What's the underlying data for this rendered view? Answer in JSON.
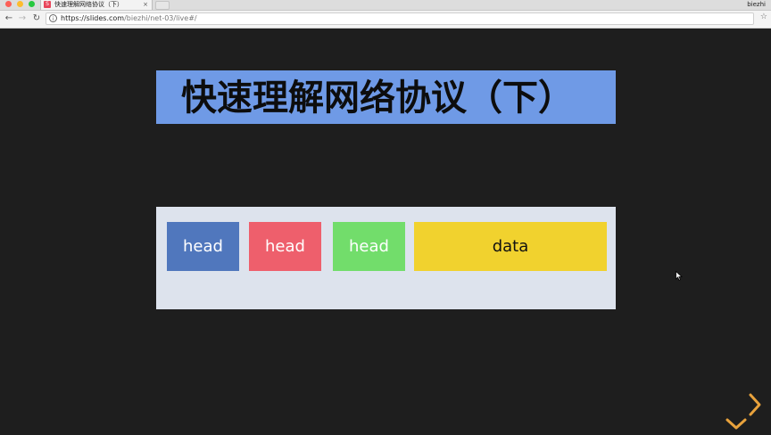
{
  "browser": {
    "tab_favicon": "S",
    "tab_title": "快速理解网络协议（下）",
    "tab_close": "×",
    "profile_name": "biezhi",
    "url_host": "https://slides.com",
    "url_path": "/biezhi/net-03/live#/",
    "icons": [
      "back-arrow-icon",
      "forward-arrow-icon",
      "reload-icon",
      "info-icon",
      "bookmark-star-icon"
    ]
  },
  "slide": {
    "title": "快速理解网络协议（下）",
    "title_bg": "#6f9ae6",
    "packet_bg": "#dde3ed",
    "segments": [
      {
        "label": "head",
        "color": "#5077bd"
      },
      {
        "label": "head",
        "color": "#ee5f6c"
      },
      {
        "label": "head",
        "color": "#72dd6b"
      },
      {
        "label": "data",
        "color": "#f1d22e"
      }
    ]
  },
  "controls": {
    "arrow_color": "#e8a23c",
    "icons": [
      "next-slide-arrow-icon",
      "down-slide-arrow-icon"
    ]
  }
}
